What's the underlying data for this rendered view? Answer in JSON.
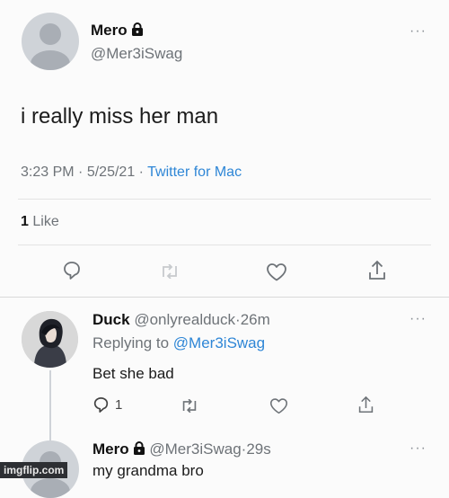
{
  "main_tweet": {
    "name": "Mero",
    "handle": "@Mer3iSwag",
    "text": "i really miss her man",
    "time": "3:23 PM",
    "date": "5/25/21",
    "source": "Twitter for Mac",
    "like_count": "1",
    "like_label": "Like",
    "sep": "·"
  },
  "reply1": {
    "name": "Duck",
    "handle": "@onlyrealduck",
    "age": "26m",
    "replying_prefix": "Replying to",
    "replying_to": "@Mer3iSwag",
    "text": "Bet she bad",
    "reply_count": "1",
    "sep": "·"
  },
  "reply2": {
    "name": "Mero",
    "handle": "@Mer3iSwag",
    "age": "29s",
    "text": "my grandma bro",
    "sep": "·"
  },
  "more_glyph": "···",
  "watermark": "imgflip.com",
  "colors": {
    "link": "#2e86d6",
    "icon": "#6e7378",
    "divider": "#e3e3e3"
  }
}
